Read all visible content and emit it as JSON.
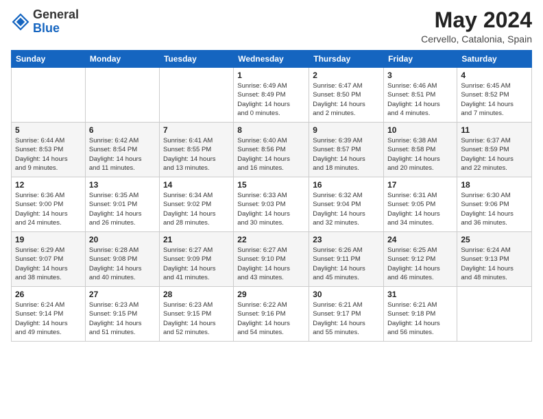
{
  "header": {
    "logo_general": "General",
    "logo_blue": "Blue",
    "month_year": "May 2024",
    "location": "Cervello, Catalonia, Spain"
  },
  "days_of_week": [
    "Sunday",
    "Monday",
    "Tuesday",
    "Wednesday",
    "Thursday",
    "Friday",
    "Saturday"
  ],
  "weeks": [
    [
      {
        "day": "",
        "info": ""
      },
      {
        "day": "",
        "info": ""
      },
      {
        "day": "",
        "info": ""
      },
      {
        "day": "1",
        "info": "Sunrise: 6:49 AM\nSunset: 8:49 PM\nDaylight: 14 hours\nand 0 minutes."
      },
      {
        "day": "2",
        "info": "Sunrise: 6:47 AM\nSunset: 8:50 PM\nDaylight: 14 hours\nand 2 minutes."
      },
      {
        "day": "3",
        "info": "Sunrise: 6:46 AM\nSunset: 8:51 PM\nDaylight: 14 hours\nand 4 minutes."
      },
      {
        "day": "4",
        "info": "Sunrise: 6:45 AM\nSunset: 8:52 PM\nDaylight: 14 hours\nand 7 minutes."
      }
    ],
    [
      {
        "day": "5",
        "info": "Sunrise: 6:44 AM\nSunset: 8:53 PM\nDaylight: 14 hours\nand 9 minutes."
      },
      {
        "day": "6",
        "info": "Sunrise: 6:42 AM\nSunset: 8:54 PM\nDaylight: 14 hours\nand 11 minutes."
      },
      {
        "day": "7",
        "info": "Sunrise: 6:41 AM\nSunset: 8:55 PM\nDaylight: 14 hours\nand 13 minutes."
      },
      {
        "day": "8",
        "info": "Sunrise: 6:40 AM\nSunset: 8:56 PM\nDaylight: 14 hours\nand 16 minutes."
      },
      {
        "day": "9",
        "info": "Sunrise: 6:39 AM\nSunset: 8:57 PM\nDaylight: 14 hours\nand 18 minutes."
      },
      {
        "day": "10",
        "info": "Sunrise: 6:38 AM\nSunset: 8:58 PM\nDaylight: 14 hours\nand 20 minutes."
      },
      {
        "day": "11",
        "info": "Sunrise: 6:37 AM\nSunset: 8:59 PM\nDaylight: 14 hours\nand 22 minutes."
      }
    ],
    [
      {
        "day": "12",
        "info": "Sunrise: 6:36 AM\nSunset: 9:00 PM\nDaylight: 14 hours\nand 24 minutes."
      },
      {
        "day": "13",
        "info": "Sunrise: 6:35 AM\nSunset: 9:01 PM\nDaylight: 14 hours\nand 26 minutes."
      },
      {
        "day": "14",
        "info": "Sunrise: 6:34 AM\nSunset: 9:02 PM\nDaylight: 14 hours\nand 28 minutes."
      },
      {
        "day": "15",
        "info": "Sunrise: 6:33 AM\nSunset: 9:03 PM\nDaylight: 14 hours\nand 30 minutes."
      },
      {
        "day": "16",
        "info": "Sunrise: 6:32 AM\nSunset: 9:04 PM\nDaylight: 14 hours\nand 32 minutes."
      },
      {
        "day": "17",
        "info": "Sunrise: 6:31 AM\nSunset: 9:05 PM\nDaylight: 14 hours\nand 34 minutes."
      },
      {
        "day": "18",
        "info": "Sunrise: 6:30 AM\nSunset: 9:06 PM\nDaylight: 14 hours\nand 36 minutes."
      }
    ],
    [
      {
        "day": "19",
        "info": "Sunrise: 6:29 AM\nSunset: 9:07 PM\nDaylight: 14 hours\nand 38 minutes."
      },
      {
        "day": "20",
        "info": "Sunrise: 6:28 AM\nSunset: 9:08 PM\nDaylight: 14 hours\nand 40 minutes."
      },
      {
        "day": "21",
        "info": "Sunrise: 6:27 AM\nSunset: 9:09 PM\nDaylight: 14 hours\nand 41 minutes."
      },
      {
        "day": "22",
        "info": "Sunrise: 6:27 AM\nSunset: 9:10 PM\nDaylight: 14 hours\nand 43 minutes."
      },
      {
        "day": "23",
        "info": "Sunrise: 6:26 AM\nSunset: 9:11 PM\nDaylight: 14 hours\nand 45 minutes."
      },
      {
        "day": "24",
        "info": "Sunrise: 6:25 AM\nSunset: 9:12 PM\nDaylight: 14 hours\nand 46 minutes."
      },
      {
        "day": "25",
        "info": "Sunrise: 6:24 AM\nSunset: 9:13 PM\nDaylight: 14 hours\nand 48 minutes."
      }
    ],
    [
      {
        "day": "26",
        "info": "Sunrise: 6:24 AM\nSunset: 9:14 PM\nDaylight: 14 hours\nand 49 minutes."
      },
      {
        "day": "27",
        "info": "Sunrise: 6:23 AM\nSunset: 9:15 PM\nDaylight: 14 hours\nand 51 minutes."
      },
      {
        "day": "28",
        "info": "Sunrise: 6:23 AM\nSunset: 9:15 PM\nDaylight: 14 hours\nand 52 minutes."
      },
      {
        "day": "29",
        "info": "Sunrise: 6:22 AM\nSunset: 9:16 PM\nDaylight: 14 hours\nand 54 minutes."
      },
      {
        "day": "30",
        "info": "Sunrise: 6:21 AM\nSunset: 9:17 PM\nDaylight: 14 hours\nand 55 minutes."
      },
      {
        "day": "31",
        "info": "Sunrise: 6:21 AM\nSunset: 9:18 PM\nDaylight: 14 hours\nand 56 minutes."
      },
      {
        "day": "",
        "info": ""
      }
    ]
  ]
}
